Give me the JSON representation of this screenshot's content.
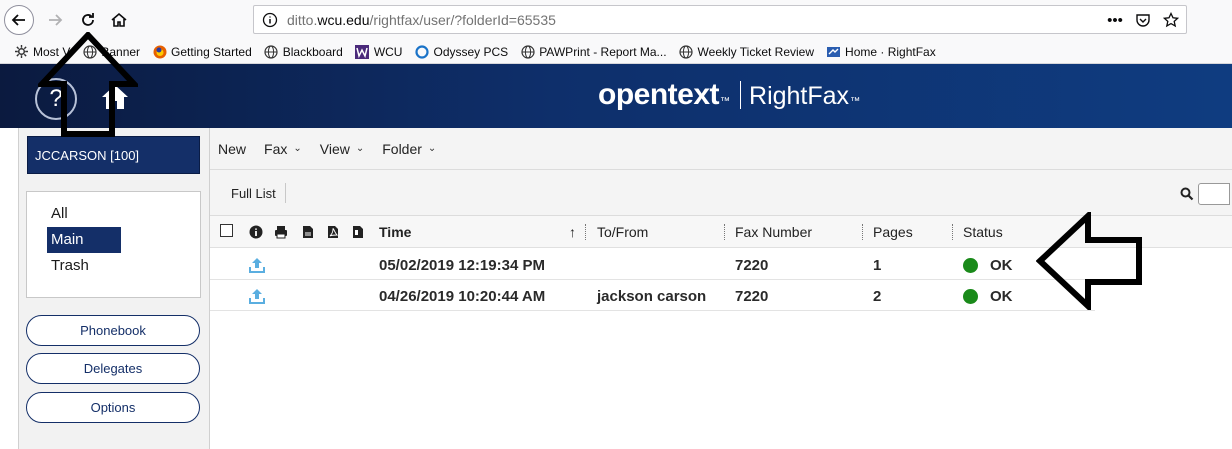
{
  "browser": {
    "url_prefix": "ditto.",
    "url_domain": "wcu.edu",
    "url_path": "/rightfax/user/?folderId=65535",
    "more_actions": "•••",
    "bookmarks": [
      {
        "label": "Most V",
        "icon": "gear-icon"
      },
      {
        "label": "Banner",
        "icon": "globe-icon"
      },
      {
        "label": "Getting Started",
        "icon": "firefox-icon"
      },
      {
        "label": "Blackboard",
        "icon": "globe-icon"
      },
      {
        "label": "WCU",
        "icon": "wcu-icon"
      },
      {
        "label": "Odyssey PCS",
        "icon": "odyssey-icon"
      },
      {
        "label": "PAWPrint - Report Ma...",
        "icon": "globe-icon"
      },
      {
        "label": "Weekly Ticket Review",
        "icon": "globe-icon"
      },
      {
        "label": "Home · RightFax",
        "icon": "rightfax-icon"
      }
    ]
  },
  "header": {
    "help": "?",
    "brand": "opentext",
    "brand_tm": "™",
    "product": "RightFax",
    "product_tm": "™"
  },
  "sidebar": {
    "user": "JCCARSON [100]",
    "folders": [
      "All",
      "Main",
      "Trash"
    ],
    "active_folder": "Main",
    "buttons": [
      "Phonebook",
      "Delegates",
      "Options"
    ]
  },
  "menubar": {
    "items": [
      "New",
      "Fax",
      "View",
      "Folder"
    ],
    "dropdown_glyph": "⌄"
  },
  "listbar": {
    "full_list": "Full List"
  },
  "grid": {
    "columns": [
      "Time",
      "To/From",
      "Fax Number",
      "Pages",
      "Status"
    ],
    "sort_arrow": "↑",
    "rows": [
      {
        "time": "05/02/2019 12:19:34 PM",
        "to_from": "",
        "fax_number": "7220",
        "pages": "1",
        "status": "OK"
      },
      {
        "time": "04/26/2019 10:20:44 AM",
        "to_from": "jackson carson",
        "fax_number": "7220",
        "pages": "2",
        "status": "OK"
      }
    ]
  },
  "colors": {
    "header_dark": "#0b1a3f",
    "header_blue": "#0f3c80",
    "accent": "#142f68",
    "status_ok": "#1a8a1a",
    "upload_icon": "#5aaee0"
  }
}
